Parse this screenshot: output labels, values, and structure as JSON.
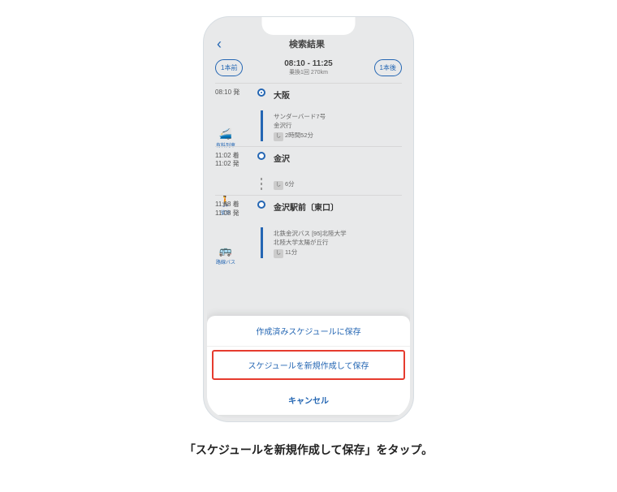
{
  "header": {
    "title": "検索結果"
  },
  "nav": {
    "prev": "1本前",
    "next": "1本後",
    "time": "08:10 - 11:25",
    "sub": "乗換1回 270km"
  },
  "stops": [
    {
      "time": "08:10 発",
      "station": "大阪"
    },
    {
      "time1": "11:02 着",
      "time2": "11:02 発",
      "station": "金沢"
    },
    {
      "time1": "11:08 着",
      "time2": "11:08 発",
      "station": "金沢駅前〔東口〕"
    }
  ],
  "segments": [
    {
      "icon_label": "有料列車",
      "line1": "サンダーバード7号",
      "line2": "金沢行",
      "badge": "し",
      "dur": "2時間52分"
    },
    {
      "icon_label": "徒歩",
      "badge": "し",
      "dur": "6分"
    },
    {
      "icon_label": "路線バス",
      "line1": "北鉄金沢バス [95]北陸大学",
      "line2": "北陸大学太陽が丘行",
      "badge": "し",
      "dur": "11分"
    }
  ],
  "sheet": {
    "opt1": "作成済みスケジュールに保存",
    "opt2": "スケジュールを新規作成して保存",
    "cancel": "キャンセル"
  },
  "caption": "「スケジュールを新規作成して保存」をタップ。"
}
